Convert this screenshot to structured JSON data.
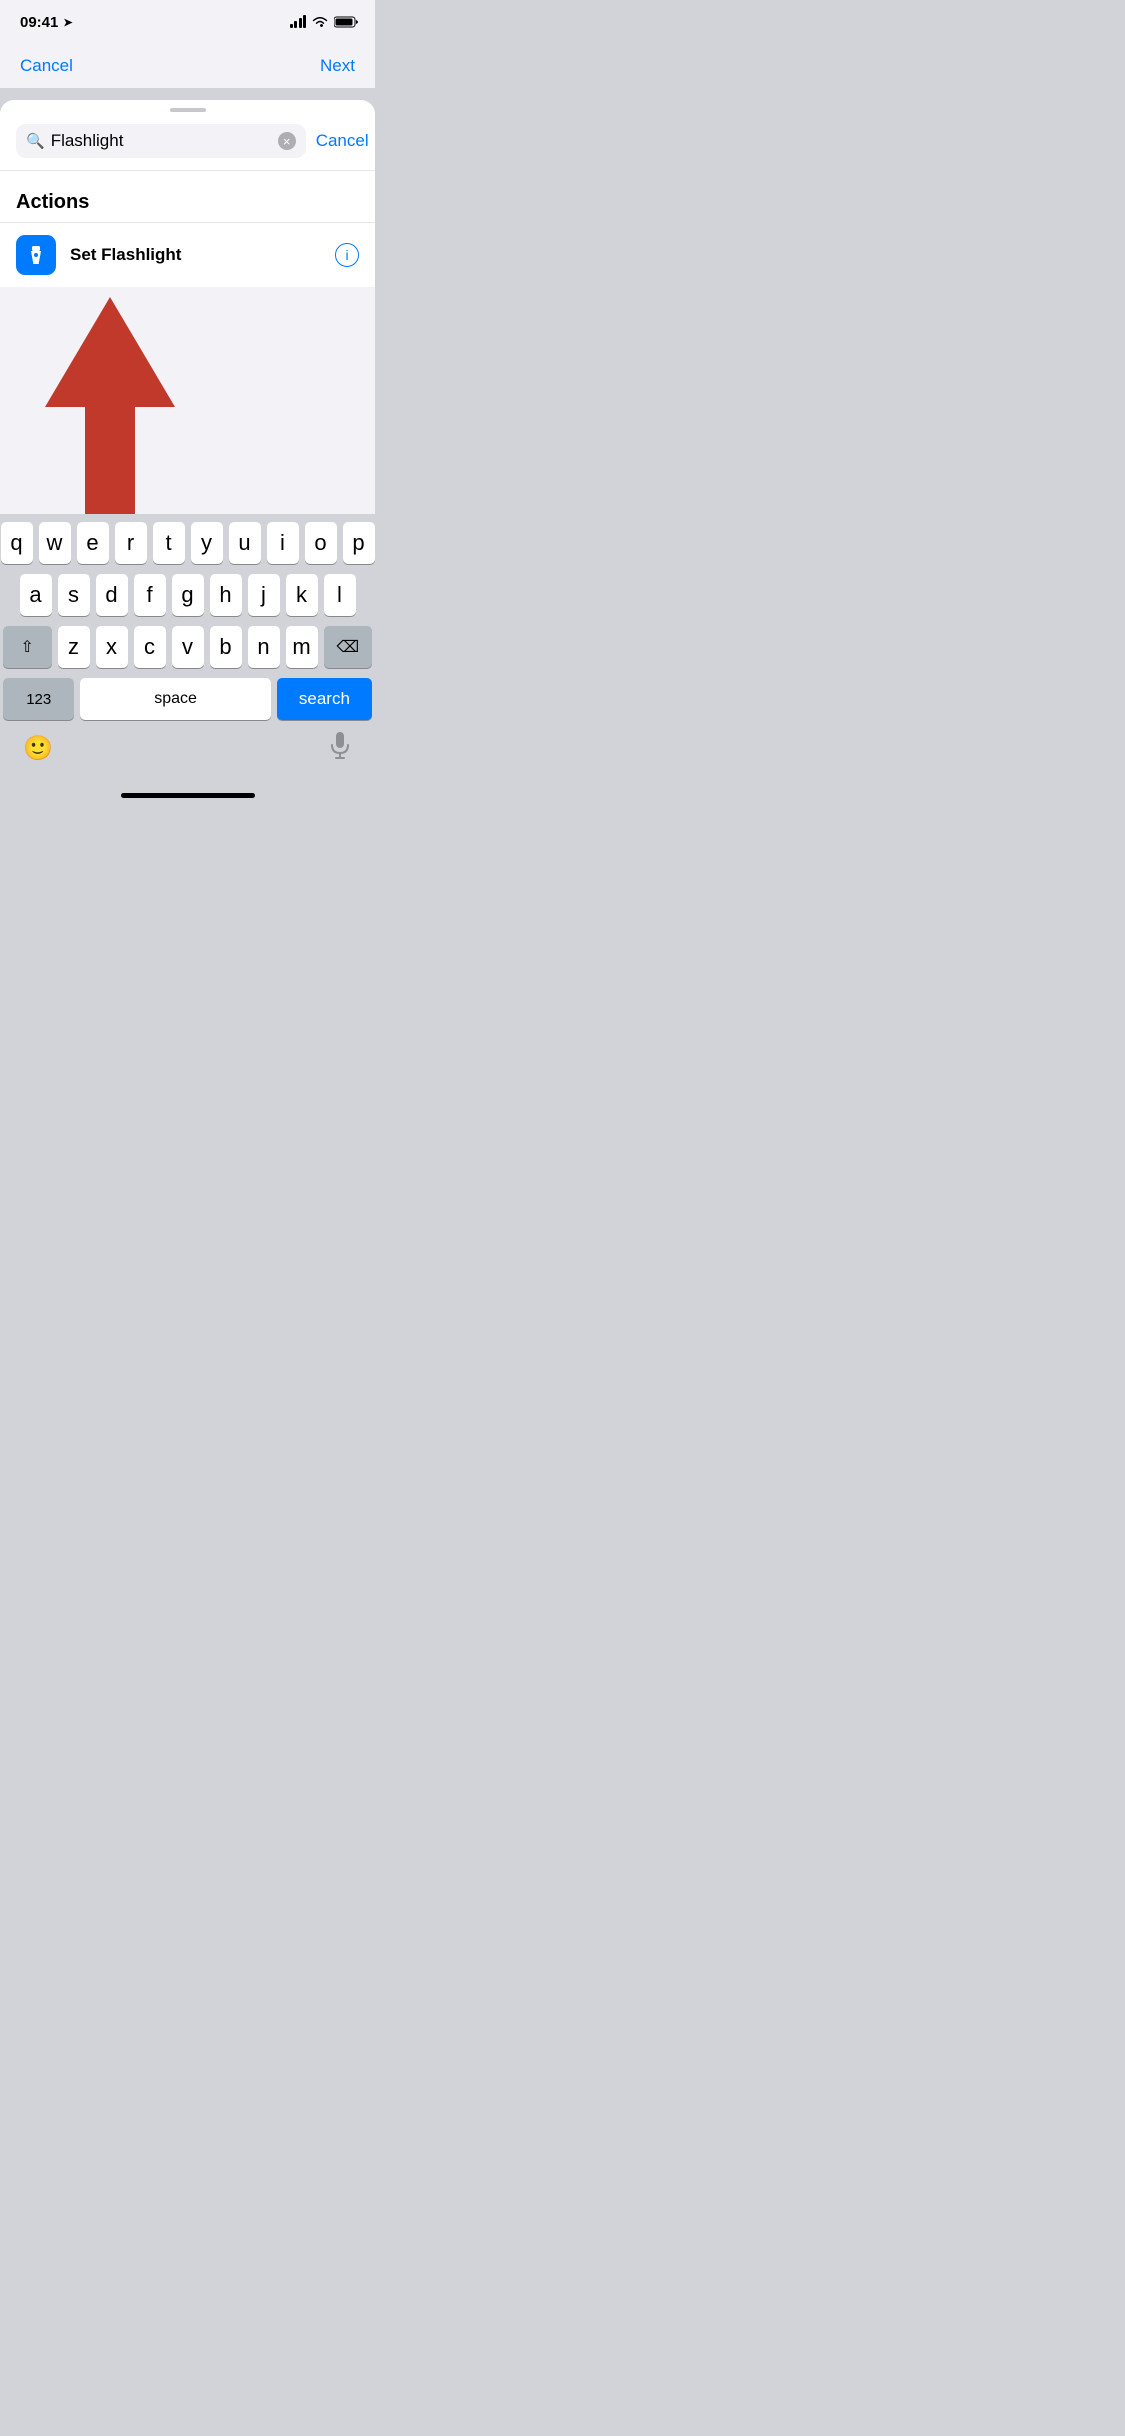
{
  "statusBar": {
    "time": "09:41",
    "locationArrow": "▲"
  },
  "bgNav": {
    "cancelLabel": "Cancel",
    "nextLabel": "Next"
  },
  "sheet": {
    "searchPlaceholder": "Flashlight",
    "searchValue": "Flashlight",
    "cancelLabel": "Cancel"
  },
  "sections": [
    {
      "title": "Actions",
      "items": [
        {
          "label": "Set Flashlight",
          "iconAlt": "flashlight-icon"
        }
      ]
    }
  ],
  "keyboard": {
    "rows": [
      [
        "q",
        "w",
        "e",
        "r",
        "t",
        "y",
        "u",
        "i",
        "o",
        "p"
      ],
      [
        "a",
        "s",
        "d",
        "f",
        "g",
        "h",
        "j",
        "k",
        "l"
      ],
      [
        "z",
        "x",
        "c",
        "v",
        "b",
        "n",
        "m"
      ]
    ],
    "numbersLabel": "123",
    "spaceLabel": "space",
    "searchLabel": "search"
  },
  "colors": {
    "blue": "#007aff",
    "flashlightBg": "#007aff",
    "arrowRed": "#c0392b"
  }
}
